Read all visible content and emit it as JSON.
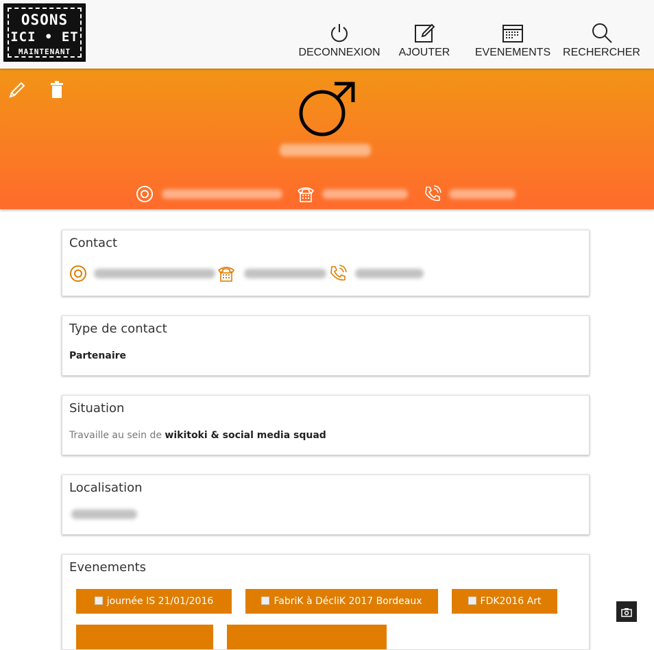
{
  "logo": {
    "line1": "OSONS",
    "line2": "ICI • ET",
    "line3": "MAINTENANT"
  },
  "nav": [
    {
      "label": "DECONNEXION",
      "icon": "power-icon"
    },
    {
      "label": "AJOUTER",
      "icon": "edit-icon"
    },
    {
      "label": "EVENEMENTS",
      "icon": "calendar-icon"
    },
    {
      "label": "RECHERCHER",
      "icon": "search-icon"
    }
  ],
  "hero": {
    "gender_icon": "male-symbol-icon",
    "action_icons": [
      "pencil-icon",
      "trash-icon"
    ],
    "contact_icons": [
      "at-sign-icon",
      "telephone-icon",
      "phone-call-icon"
    ]
  },
  "colors": {
    "accent": "#e07d00",
    "hero_top": "#f29416",
    "hero_bottom": "#ff6b2c"
  },
  "cards": {
    "contact": {
      "title": "Contact"
    },
    "type": {
      "title": "Type de contact",
      "value": "Partenaire"
    },
    "situation": {
      "title": "Situation",
      "prefix": "Travaille au sein de",
      "company": "wikitoki & social media squad"
    },
    "localisation": {
      "title": "Localisation"
    },
    "evenements": {
      "title": "Evenements",
      "tags": [
        "journée IS 21/01/2016",
        "FabriK à DécliK 2017 Bordeaux",
        "FDK2016 Art"
      ]
    }
  }
}
